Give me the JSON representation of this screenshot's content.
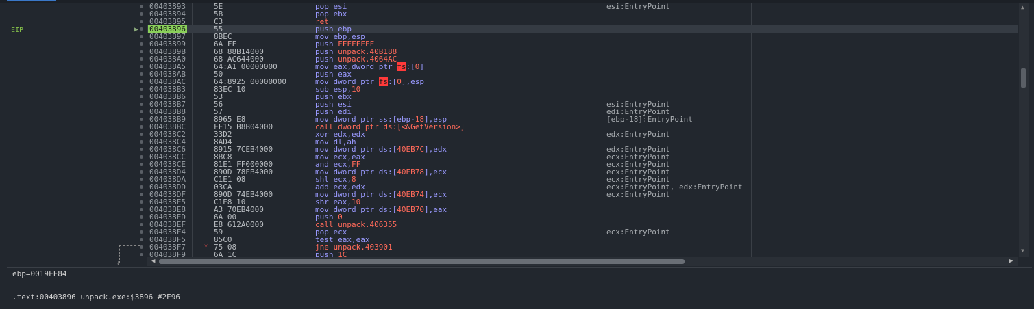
{
  "eip_label": "EIP",
  "rows": [
    {
      "addr": "00403893",
      "bytes": "5E",
      "ins": [
        [
          "pop esi",
          "n"
        ]
      ],
      "comment": "esi:EntryPoint"
    },
    {
      "addr": "00403894",
      "bytes": "5B",
      "ins": [
        [
          "pop ebx",
          "n"
        ]
      ],
      "comment": ""
    },
    {
      "addr": "00403895",
      "bytes": "C3",
      "ins": [
        [
          "ret",
          "r"
        ]
      ],
      "comment": ""
    },
    {
      "addr": "00403896",
      "bytes": "55",
      "ins": [
        [
          "push ebp",
          "n"
        ]
      ],
      "comment": "",
      "current": true
    },
    {
      "addr": "00403897",
      "bytes": "8BEC",
      "ins": [
        [
          "mov ebp,esp",
          "n"
        ]
      ],
      "comment": ""
    },
    {
      "addr": "00403899",
      "bytes": "6A FF",
      "ins": [
        [
          "push ",
          "n"
        ],
        [
          "FFFFFFFF",
          "r"
        ]
      ],
      "comment": ""
    },
    {
      "addr": "0040389B",
      "bytes": "68 88B14000",
      "ins": [
        [
          "push ",
          "n"
        ],
        [
          "unpack.40B188",
          "r"
        ]
      ],
      "comment": ""
    },
    {
      "addr": "004038A0",
      "bytes": "68 AC644000",
      "ins": [
        [
          "push ",
          "n"
        ],
        [
          "unpack.4064AC",
          "r"
        ]
      ],
      "comment": ""
    },
    {
      "addr": "004038A5",
      "bytes": "64:A1 00000000",
      "ins": [
        [
          "mov eax,dword ptr ",
          "n"
        ],
        [
          "fs",
          "s"
        ],
        [
          ":[",
          "n"
        ],
        [
          "0",
          "r"
        ],
        [
          "]",
          "n"
        ]
      ],
      "comment": ""
    },
    {
      "addr": "004038AB",
      "bytes": "50",
      "ins": [
        [
          "push eax",
          "n"
        ]
      ],
      "comment": ""
    },
    {
      "addr": "004038AC",
      "bytes": "64:8925 00000000",
      "ins": [
        [
          "mov dword ptr ",
          "n"
        ],
        [
          "fs",
          "s"
        ],
        [
          ":[",
          "n"
        ],
        [
          "0",
          "r"
        ],
        [
          "],esp",
          "n"
        ]
      ],
      "comment": ""
    },
    {
      "addr": "004038B3",
      "bytes": "83EC 10",
      "ins": [
        [
          "sub esp,",
          "n"
        ],
        [
          "10",
          "r"
        ]
      ],
      "comment": ""
    },
    {
      "addr": "004038B6",
      "bytes": "53",
      "ins": [
        [
          "push ebx",
          "n"
        ]
      ],
      "comment": ""
    },
    {
      "addr": "004038B7",
      "bytes": "56",
      "ins": [
        [
          "push esi",
          "n"
        ]
      ],
      "comment": "esi:EntryPoint"
    },
    {
      "addr": "004038B8",
      "bytes": "57",
      "ins": [
        [
          "push edi",
          "n"
        ]
      ],
      "comment": "edi:EntryPoint"
    },
    {
      "addr": "004038B9",
      "bytes": "8965 E8",
      "ins": [
        [
          "mov dword ptr ss:[ebp-",
          "n"
        ],
        [
          "18",
          "r"
        ],
        [
          "],esp",
          "n"
        ]
      ],
      "comment": "[ebp-18]:EntryPoint"
    },
    {
      "addr": "004038BC",
      "bytes": "FF15 B8B04000",
      "ins": [
        [
          "call dword ptr ds:[<&GetVersion>]",
          "c"
        ]
      ],
      "comment": ""
    },
    {
      "addr": "004038C2",
      "bytes": "33D2",
      "ins": [
        [
          "xor edx,edx",
          "n"
        ]
      ],
      "comment": "edx:EntryPoint"
    },
    {
      "addr": "004038C4",
      "bytes": "8AD4",
      "ins": [
        [
          "mov dl,ah",
          "n"
        ]
      ],
      "comment": ""
    },
    {
      "addr": "004038C6",
      "bytes": "8915 7CEB4000",
      "ins": [
        [
          "mov dword ptr ds:[",
          "n"
        ],
        [
          "40EB7C",
          "r"
        ],
        [
          "],edx",
          "n"
        ]
      ],
      "comment": "edx:EntryPoint"
    },
    {
      "addr": "004038CC",
      "bytes": "8BC8",
      "ins": [
        [
          "mov ecx,eax",
          "n"
        ]
      ],
      "comment": "ecx:EntryPoint"
    },
    {
      "addr": "004038CE",
      "bytes": "81E1 FF000000",
      "ins": [
        [
          "and ecx,",
          "n"
        ],
        [
          "FF",
          "r"
        ]
      ],
      "comment": "ecx:EntryPoint"
    },
    {
      "addr": "004038D4",
      "bytes": "890D 78EB4000",
      "ins": [
        [
          "mov dword ptr ds:[",
          "n"
        ],
        [
          "40EB78",
          "r"
        ],
        [
          "],ecx",
          "n"
        ]
      ],
      "comment": "ecx:EntryPoint"
    },
    {
      "addr": "004038DA",
      "bytes": "C1E1 08",
      "ins": [
        [
          "shl ecx,",
          "n"
        ],
        [
          "8",
          "r"
        ]
      ],
      "comment": "ecx:EntryPoint"
    },
    {
      "addr": "004038DD",
      "bytes": "03CA",
      "ins": [
        [
          "add ecx,edx",
          "n"
        ]
      ],
      "comment": "ecx:EntryPoint, edx:EntryPoint"
    },
    {
      "addr": "004038DF",
      "bytes": "890D 74EB4000",
      "ins": [
        [
          "mov dword ptr ds:[",
          "n"
        ],
        [
          "40EB74",
          "r"
        ],
        [
          "],ecx",
          "n"
        ]
      ],
      "comment": "ecx:EntryPoint"
    },
    {
      "addr": "004038E5",
      "bytes": "C1E8 10",
      "ins": [
        [
          "shr eax,",
          "n"
        ],
        [
          "10",
          "r"
        ]
      ],
      "comment": ""
    },
    {
      "addr": "004038E8",
      "bytes": "A3 70EB4000",
      "ins": [
        [
          "mov dword ptr ds:[",
          "n"
        ],
        [
          "40EB70",
          "r"
        ],
        [
          "],eax",
          "n"
        ]
      ],
      "comment": ""
    },
    {
      "addr": "004038ED",
      "bytes": "6A 00",
      "ins": [
        [
          "push ",
          "n"
        ],
        [
          "0",
          "r"
        ]
      ],
      "comment": ""
    },
    {
      "addr": "004038EF",
      "bytes": "E8 612A0000",
      "ins": [
        [
          "call unpack.406355",
          "c"
        ]
      ],
      "comment": ""
    },
    {
      "addr": "004038F4",
      "bytes": "59",
      "ins": [
        [
          "pop ecx",
          "n"
        ]
      ],
      "comment": "ecx:EntryPoint"
    },
    {
      "addr": "004038F5",
      "bytes": "85C0",
      "ins": [
        [
          "test eax,eax",
          "n"
        ]
      ],
      "comment": ""
    },
    {
      "addr": "004038F7",
      "bytes": "75 08",
      "ins": [
        [
          "jne unpack.403901",
          "c"
        ]
      ],
      "comment": "",
      "jump": true
    },
    {
      "addr": "004038F9",
      "bytes": "6A 1C",
      "ins": [
        [
          "push ",
          "n"
        ],
        [
          "1C",
          "r"
        ]
      ],
      "comment": ""
    }
  ],
  "info": {
    "line1": "ebp=0019FF84",
    "line2": ".text:00403896 unpack.exe:$3896 #2E96"
  },
  "colors": {
    "bg": "#22272e",
    "eip_highlight": "#8ad05a",
    "instruction": "#9a9aff",
    "immediate": "#ff6a5a",
    "segment_bg": "#ff3a3a"
  }
}
